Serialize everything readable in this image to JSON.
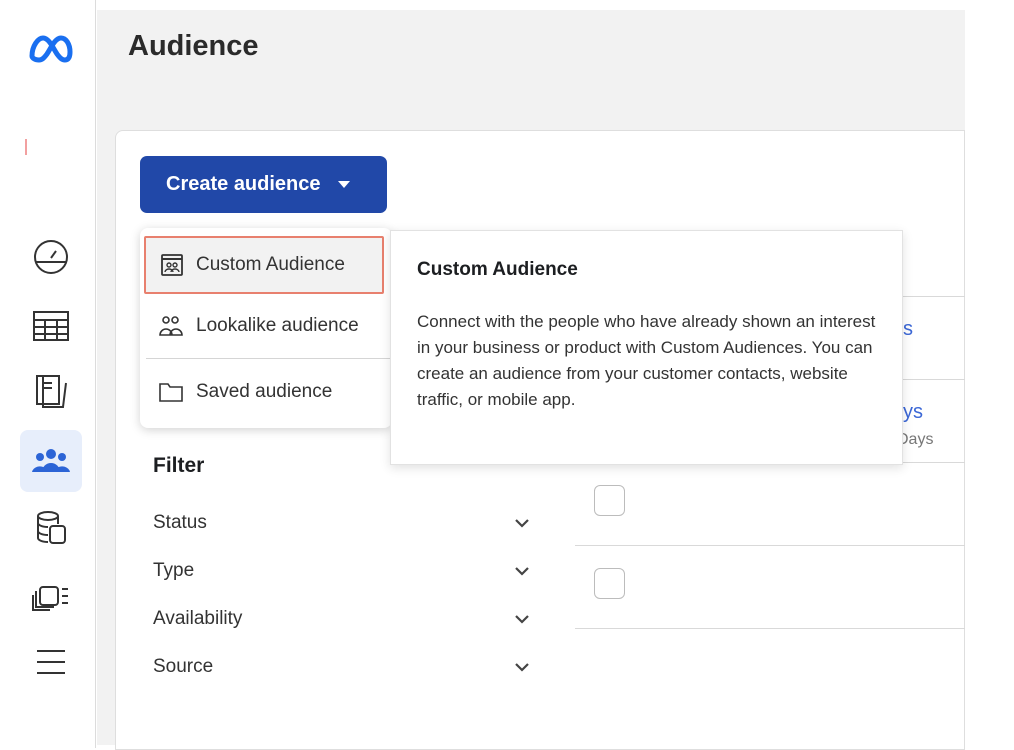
{
  "sidebar": {
    "items": [
      {
        "icon": "meta-logo-icon"
      },
      {
        "icon": "gauge-icon"
      },
      {
        "icon": "table-icon"
      },
      {
        "icon": "pages-icon"
      },
      {
        "icon": "audience-icon",
        "active": true
      },
      {
        "icon": "database-icon"
      },
      {
        "icon": "catalog-icon"
      },
      {
        "icon": "menu-icon"
      }
    ]
  },
  "header": {
    "title": "Audience"
  },
  "toolbar": {
    "create_label": "Create audience"
  },
  "dropdown": {
    "items": [
      {
        "label": "Custom Audience",
        "icon": "custom-audience-icon",
        "selected": true
      },
      {
        "label": "Lookalike audience",
        "icon": "people-icon"
      },
      {
        "label": "Saved audience",
        "icon": "folder-icon"
      }
    ]
  },
  "tooltip": {
    "title": "Custom Audience",
    "body": "Connect with the people who have already shown an interest in your business or product with Custom Audiences. You can create an audience from your customer contacts, website traffic, or mobile app."
  },
  "table": {
    "partial": [
      "s",
      "ys",
      "Days"
    ]
  },
  "filter": {
    "title": "Filter",
    "items": [
      "Status",
      "Type",
      "Availability",
      "Source"
    ]
  },
  "colors": {
    "accent": "#2148a8",
    "highlight_border": "#e8806e",
    "link": "#3b67d6"
  }
}
